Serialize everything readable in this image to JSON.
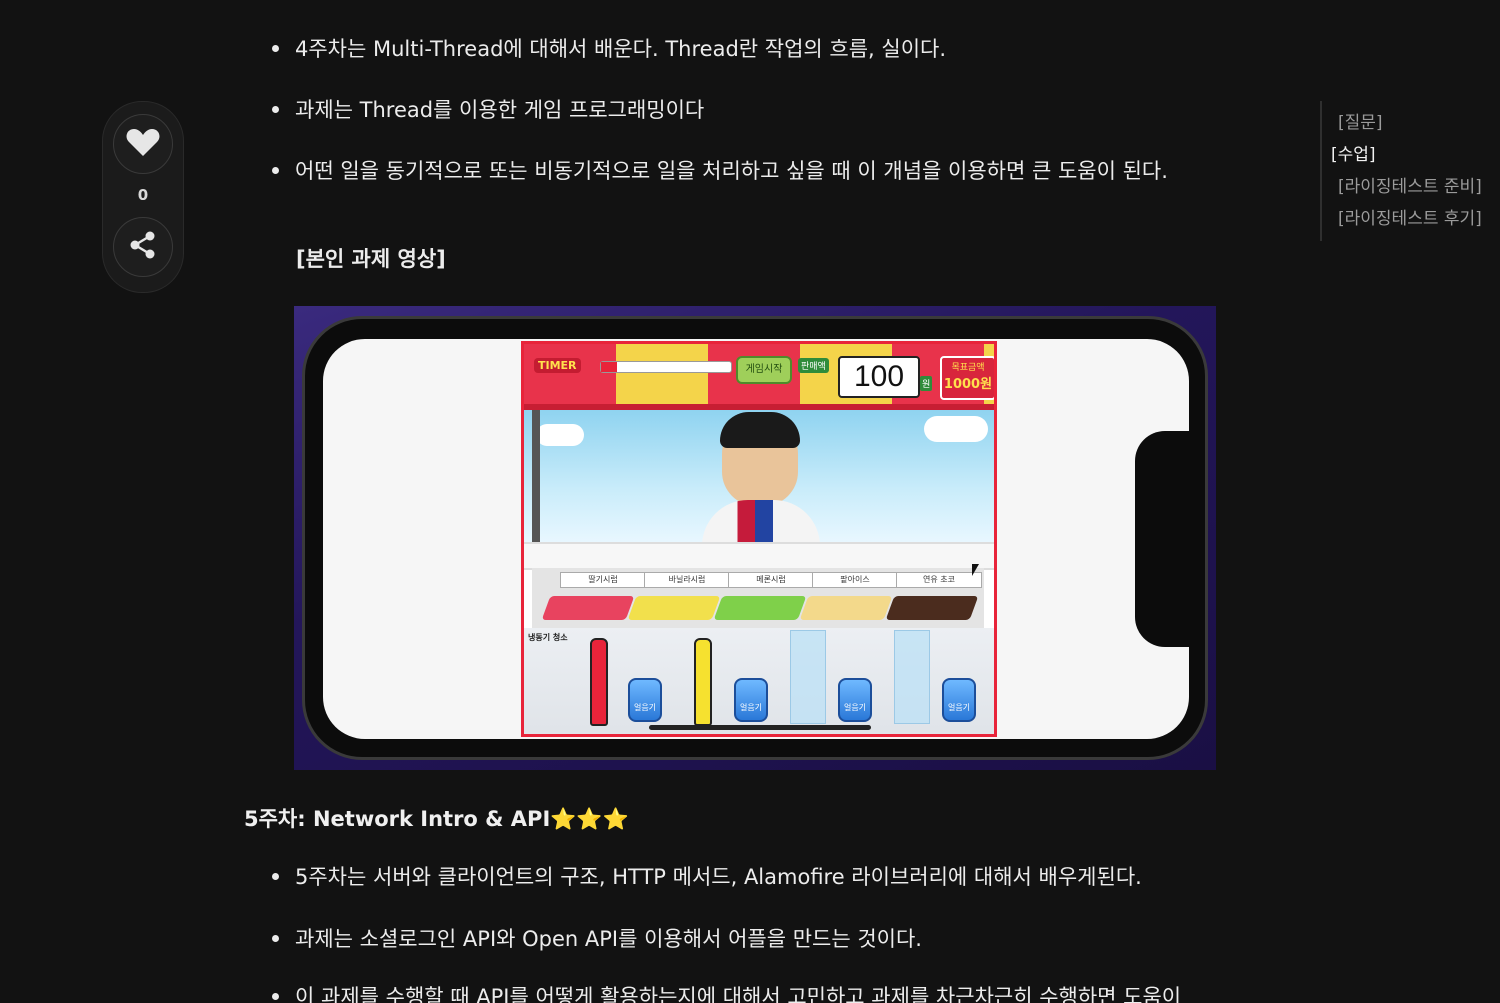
{
  "side_panel": {
    "like_count": "0"
  },
  "toc": {
    "items": [
      {
        "label": "[질문]"
      },
      {
        "label": "[수업]"
      },
      {
        "label": "[라이징테스트 준비]"
      },
      {
        "label": "[라이징테스트 후기]"
      }
    ]
  },
  "article": {
    "bullets_week4": [
      "4주차는 Multi-Thread에 대해서 배운다. Thread란 작업의 흐름, 실이다.",
      "과제는 Thread를 이용한 게임 프로그래밍이다",
      "어떤 일을 동기적으로 또는 비동기적으로 일을 처리하고 싶을 때 이 개념을 이용하면 큰 도움이 된다."
    ],
    "sub_heading": "[본인 과제 영상]",
    "section_heading": "5주차: Network Intro & API",
    "section_heading_stars": "⭐⭐⭐",
    "bullets_week5": [
      "5주차는 서버와 클라이언트의 구조, HTTP 메서드, Alamofire 라이브러리에 대해서 배우게된다.",
      "과제는 소셜로그인 API와 Open API를 이용해서 어플을 만드는 것이다.",
      "이 과제를 수행할 때 API를 어떻게 활용하는지에 대해서 고민하고 과제를 차근차근히 수행하면 도움이"
    ]
  },
  "game": {
    "timer_label": "TIMER",
    "timer_progress": 0.12,
    "start_label": "게임시작",
    "sales_label": "판매액",
    "score": "100",
    "won": "원",
    "goal_label": "목표금액",
    "goal_amount": "1000원",
    "tray_labels": [
      "딸기시럽",
      "바닐라시럽",
      "메론시럽",
      "팥아이스",
      "연유 초코"
    ],
    "freezer_label": "냉동기 청소",
    "ice_label": "얼음기"
  },
  "colors": {
    "background": "#121212",
    "text": "#ececec",
    "accent_star": "#ffcc33",
    "game_border": "#e8243a"
  }
}
